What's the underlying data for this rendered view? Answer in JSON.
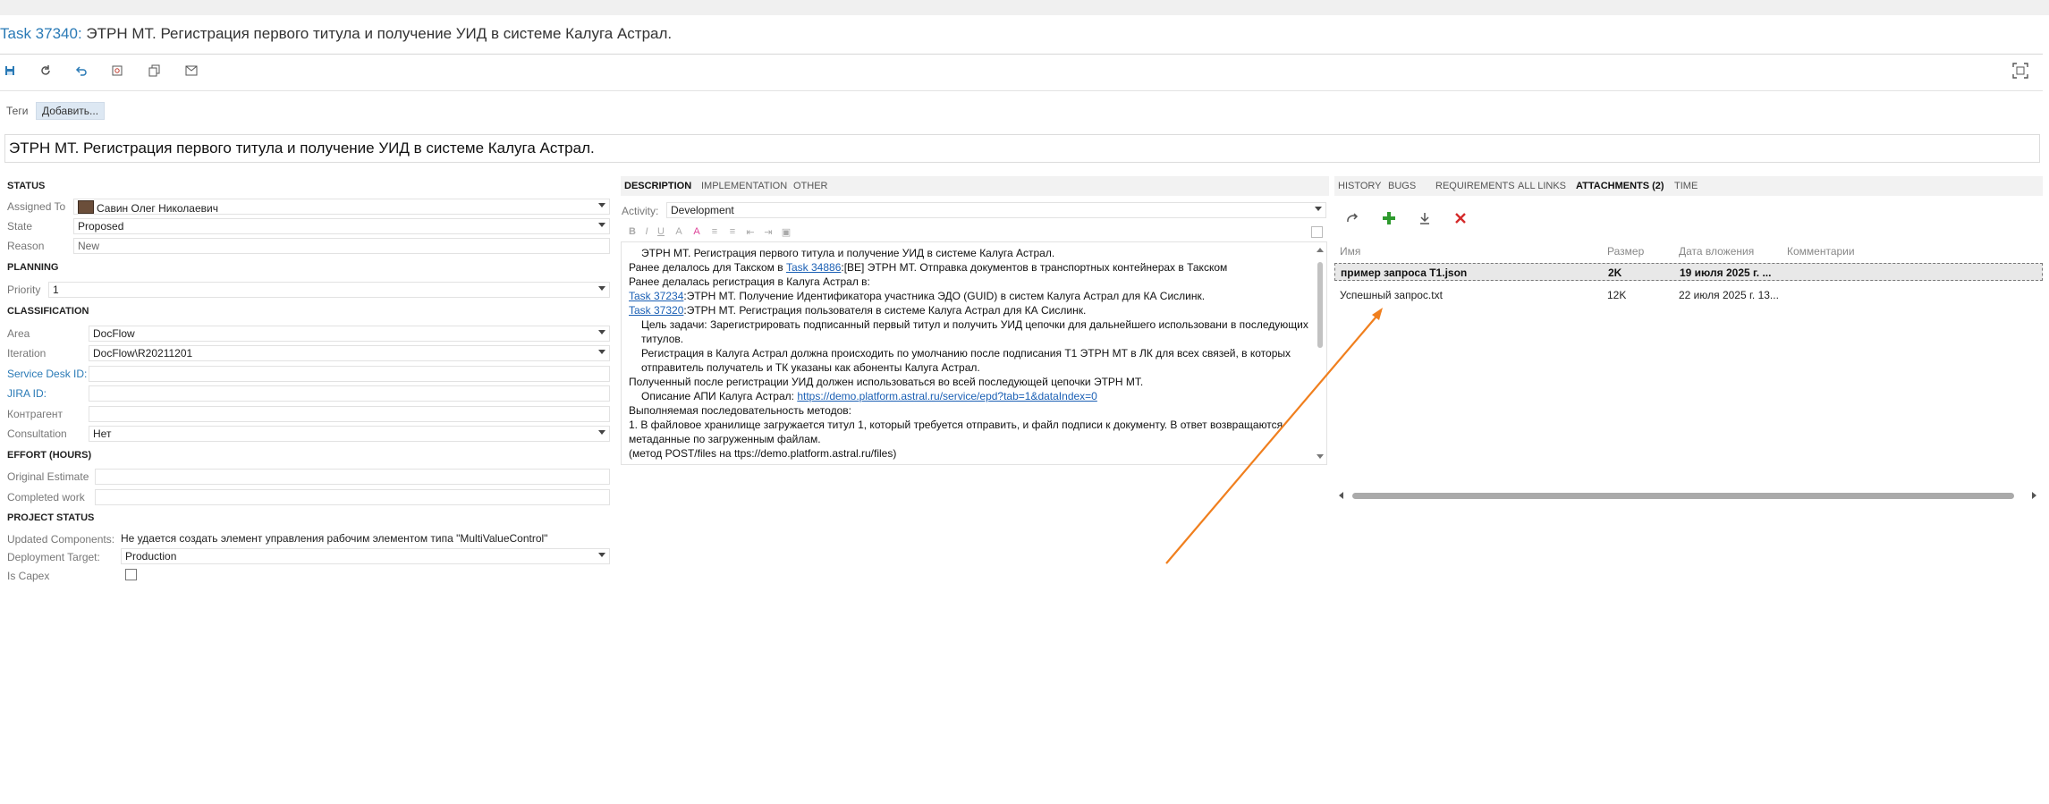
{
  "header": {
    "task_link": "Task 37340:",
    "task_title": " ЭТРН МТ. Регистрация первого титула и получение УИД в системе Калуга Астрал."
  },
  "toolbar": {
    "icons": [
      "save-icon",
      "refresh-icon",
      "undo-icon",
      "settings-icon",
      "copy-icon",
      "mail-icon"
    ],
    "fullscreen_icon": "fullscreen-icon"
  },
  "tags": {
    "label": "Теги",
    "add_button": "Добавить..."
  },
  "summary": "ЭТРН МТ. Регистрация первого титула и получение УИД в системе Калуга Астрал.",
  "form": {
    "status": {
      "header": "STATUS",
      "assigned_to_label": "Assigned To",
      "assigned_to_value": "Савин Олег Николаевич",
      "state_label": "State",
      "state_value": "Proposed",
      "reason_label": "Reason",
      "reason_value": "New"
    },
    "planning": {
      "header": "PLANNING",
      "priority_label": "Priority",
      "priority_value": "1"
    },
    "classification": {
      "header": "CLASSIFICATION",
      "area_label": "Area",
      "area_value": "DocFlow",
      "iteration_label": "Iteration",
      "iteration_value": "DocFlow\\R20211201",
      "service_desk_label": "Service Desk ID:",
      "service_desk_value": "",
      "jira_label": "JIRA ID:",
      "jira_value": "",
      "counterparty_label": "Контрагент",
      "counterparty_value": "",
      "consultation_label": "Consultation",
      "consultation_value": "Нет"
    },
    "effort": {
      "header": "EFFORT (HOURS)",
      "original_label": "Original Estimate",
      "original_value": "",
      "completed_label": "Completed work",
      "completed_value": ""
    },
    "project_status": {
      "header": "PROJECT STATUS",
      "updated_components_label": "Updated Components:",
      "updated_components_value": "Не удается создать элемент управления рабочим элементом типа \"MultiValueControl\"",
      "deployment_target_label": "Deployment Target:",
      "deployment_target_value": "Production",
      "is_capex_label": "Is Capex",
      "is_capex_checked": false
    }
  },
  "middle": {
    "tabs": [
      "DESCRIPTION",
      "IMPLEMENTATION",
      "OTHER"
    ],
    "active_tab": "DESCRIPTION",
    "activity_label": "Activity:",
    "activity_value": "Development",
    "rte_buttons": [
      "B",
      "I",
      "U",
      "A",
      "A",
      "≡",
      "≡",
      "⇤",
      "⇥",
      "▣"
    ],
    "description": {
      "l1": "ЭТРН МТ. Регистрация первого титула и получение УИД в системе Калуга Астрал.",
      "l2_pre": "Ранее делалось для Такском в ",
      "l2_link": "Task 34886",
      "l2_post": ":[BE] ЭТРН МТ. Отправка документов в транспортных контейнерах в Такском",
      "l3": "Ранее делалась регистрация в Калуга Астрал в:",
      "l4_link": "Task 37234",
      "l4_post": ":ЭТРН МТ. Получение Идентификатора участника ЭДО (GUID) в систем Калуга Астрал для КА Сислинк.",
      "l5_link": "Task 37320",
      "l5_post": ":ЭТРН МТ. Регистрация пользователя в системе Калуга Астрал для КА Сислинк.",
      "l6": "Цель задачи: Зарегистрировать подписанный первый титул и получить УИД цепочки для дальнейшего использовани в последующих титулов.",
      "l7": "Регистрация в Калуга Астрал должна происходить по умолчанию после подписания Т1 ЭТРН МТ в ЛК для всех связей, в которых отправитель получатель и ТК указаны как абоненты Калуга Астрал.",
      "l8": "Полученный после регистрации УИД должен использоваться во всей последующей цепочки ЭТРН МТ.",
      "l9_pre": "Описание АПИ Калуга Астрал:  ",
      "l9_link": "https://demo.platform.astral.ru/service/epd?tab=1&dataIndex=0",
      "l10": "Выполняемая последовательность методов:",
      "l11": "1. В файловое хранилище загружается титул 1, который требуется отправить, и файл подписи к документу. В ответ возвращаются метаданные по загруженным файлам.",
      "l12": " (метод POST/files на ttps://demo.platform.astral.ru/files)"
    }
  },
  "right": {
    "tabs": [
      "HISTORY",
      "BUGS",
      "REQUIREMENTS",
      "ALL LINKS",
      "ATTACHMENTS (2)",
      "TIME"
    ],
    "active_tab": "ATTACHMENTS (2)",
    "toolbar_icons": [
      "open-icon",
      "add-icon",
      "download-icon",
      "delete-icon"
    ],
    "columns": [
      "Имя",
      "Размер",
      "Дата вложения",
      "Комментарии"
    ],
    "rows": [
      {
        "name": "пример запроса Т1.json",
        "size": "2K",
        "date": "19 июля 2025 г. ...",
        "comment": ""
      },
      {
        "name": "Успешный запрос.txt",
        "size": "12K",
        "date": "22 июля 2025 г. 13...",
        "comment": ""
      }
    ],
    "accent_color": "#f07f1e"
  }
}
